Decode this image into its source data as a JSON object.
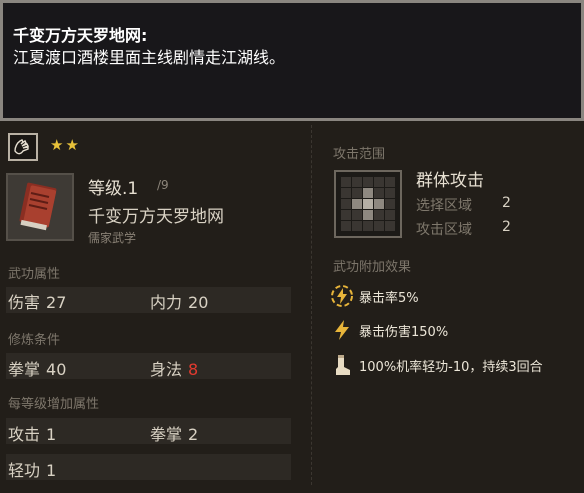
{
  "tooltip": {
    "title": "千变万方天罗地网:",
    "description": "江夏渡口酒楼里面主线剧情走江湖线。"
  },
  "skill": {
    "stars": "★★",
    "level_label": "等级.1",
    "level_max": "/9",
    "name": "千变万方天罗地网",
    "school": "儒家武学"
  },
  "attributes": {
    "section_label": "武功属性",
    "damage_label": "伤害",
    "damage_value": "27",
    "internal_label": "内力",
    "internal_value": "20"
  },
  "requirements": {
    "section_label": "修炼条件",
    "fist_label": "拳掌",
    "fist_value": "40",
    "body_label": "身法",
    "body_value": "8",
    "body_value_color": "#e23a2f"
  },
  "per_level": {
    "section_label": "每等级增加属性",
    "attack_label": "攻击",
    "attack_value": "1",
    "fist_label": "拳掌",
    "fist_value": "2",
    "lightness_label": "轻功",
    "lightness_value": "1"
  },
  "attack_range": {
    "section_label": "攻击范围",
    "type": "群体攻击",
    "select_label": "选择区域",
    "select_value": "2",
    "attack_label": "攻击区域",
    "attack_value": "2"
  },
  "effects": {
    "section_label": "武功附加效果",
    "items": [
      {
        "icon": "lightning-circle-icon",
        "text": "暴击率5%"
      },
      {
        "icon": "lightning-icon",
        "text": "暴击伤害150%"
      },
      {
        "icon": "boot-icon",
        "text": "100%机率轻功-10，持续3回合"
      }
    ]
  },
  "colors": {
    "star": "#e8c23a",
    "highlight_red": "#e23a2f",
    "effect_icon": "#e8b53a"
  }
}
